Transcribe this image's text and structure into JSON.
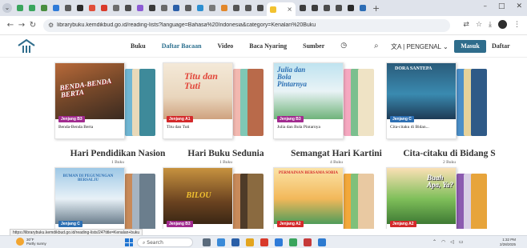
{
  "browser": {
    "url": "librarybuku.kemdikbud.go.id/reading-lists?language=Bahasa%20Indonesia&category=Kenalan%20Buku",
    "tabs": [
      {
        "color": "#3aa55d"
      },
      {
        "color": "#3aa55d"
      },
      {
        "color": "#4a8e3f"
      },
      {
        "color": "#2f7bd8"
      },
      {
        "color": "#5a5a5a"
      },
      {
        "color": "#2b2b2b"
      },
      {
        "color": "#e04e3a"
      },
      {
        "color": "#d93a2b"
      },
      {
        "color": "#6e6e6e"
      },
      {
        "color": "#4c4c4c"
      },
      {
        "color": "#8c5bd4"
      },
      {
        "color": "#3a3a3a"
      },
      {
        "color": "#6a6a6a"
      },
      {
        "color": "#2b5fa8"
      },
      {
        "color": "#5c5c5c"
      },
      {
        "color": "#2e8fd1"
      },
      {
        "color": "#7a7a7a"
      },
      {
        "color": "#e2872b"
      },
      {
        "color": "#555555"
      },
      {
        "color": "#555555"
      },
      {
        "color": "#4a4a4a"
      },
      {
        "color": "#f2c230"
      },
      {
        "color": "#3d3d3d"
      },
      {
        "color": "#3d3d3d"
      },
      {
        "color": "#4c4c4c"
      },
      {
        "color": "#4c4c4c"
      },
      {
        "color": "#2a2a2a"
      },
      {
        "color": "#2d6db5"
      }
    ],
    "active_tab_close": "×",
    "new_tab": "+"
  },
  "site": {
    "nav": [
      "Buku",
      "Daftar Bacaan",
      "Video",
      "Baca Nyaring",
      "Sumber"
    ],
    "active_nav": "Daftar Bacaan",
    "language": "PENGENAL",
    "login_label": "Masuk",
    "register_label": "Daftar",
    "colors": {
      "primary": "#2f6d8c"
    }
  },
  "collections": [
    {
      "title": "Hari Pendidikan Nasion",
      "count": "1 Buku",
      "book": {
        "title": "Benda-Benda Berta",
        "level": "Jenjang B3",
        "level_color": "#a12b8f",
        "cover_text": "BENDA-BENDA BERTA"
      },
      "back_colors": [
        "#6fb6d3",
        "#e8d9b9",
        "#3e8a9a"
      ]
    },
    {
      "title": "Hari Buku Sedunia",
      "count": "1 Buku",
      "book": {
        "title": "Titu dan Tuti",
        "level": "Jenjang A1",
        "level_color": "#d4292b",
        "cover_text": "Titu dan Tuti"
      },
      "back_colors": [
        "#f2b8b0",
        "#7fc7b5",
        "#b96a4a"
      ]
    },
    {
      "title": "Semangat Hari Kartini",
      "count": "4 Buku",
      "book": {
        "title": "Julia dan Bola Pintarnya",
        "level": "Jenjang B3",
        "level_color": "#a12b8f",
        "cover_text": "Julia dan Bola Pintarnya"
      },
      "back_colors": [
        "#f5a8c0",
        "#7bbf8e",
        "#efe3c5"
      ]
    },
    {
      "title": "Cita-citaku di Bidang S",
      "count": "2 Buku",
      "book": {
        "title": "Cita-citaku di Bidan...",
        "level": "Jenjang C",
        "level_color": "#2c6fb3",
        "cover_text": "DORA SANTEPA"
      },
      "back_colors": [
        "#4b8fc8",
        "#e6d29a",
        "#2f5a87"
      ]
    },
    {
      "title": "",
      "count": "",
      "book": {
        "title": "",
        "level": "Jenjang C",
        "level_color": "#2c6fb3",
        "cover_text": "BUMAN DI PEGUNUNGAN BERSALJU"
      },
      "back_colors": [
        "#c88a5a",
        "#a6b4c2",
        "#6b7e8d"
      ]
    },
    {
      "title": "",
      "count": "",
      "book": {
        "title": "",
        "level": "Jenjang B3",
        "level_color": "#a12b8f",
        "cover_text": "BILOU"
      },
      "back_colors": [
        "#c88a5a",
        "#4e3b28",
        "#8a6a40"
      ]
    },
    {
      "title": "",
      "count": "",
      "book": {
        "title": "",
        "level": "Jenjang A2",
        "level_color": "#d4292b",
        "cover_text": "PERMAINAN BERSAMA SOBIA"
      },
      "back_colors": [
        "#f2a83a",
        "#7fc07a",
        "#e9c9a2"
      ]
    },
    {
      "title": "",
      "count": "",
      "book": {
        "title": "",
        "level": "Jenjang A2",
        "level_color": "#d4292b",
        "cover_text": "Buah Apa, Ya?"
      },
      "back_colors": [
        "#8c5bb0",
        "#d9d0e6",
        "#e7a43b"
      ]
    }
  ],
  "status_url": "https://librarybuku.kemdikbud.go.id/reading-lists/24?title=Kenalan+buku",
  "taskbar": {
    "weather_temp": "30°F",
    "weather_desc": "Partly sunny",
    "search_placeholder": "Search",
    "apps": [
      {
        "color": "#5a6b7c"
      },
      {
        "color": "#3b8bd8"
      },
      {
        "color": "#2a5fa8"
      },
      {
        "color": "#e3a51f"
      },
      {
        "color": "#d93a2b"
      },
      {
        "color": "#2f7bd8"
      },
      {
        "color": "#3aa55d"
      },
      {
        "color": "#c63a3a"
      },
      {
        "color": "#2d7bd0"
      }
    ],
    "time": "1:32 PM",
    "date": "2/28/2025"
  }
}
